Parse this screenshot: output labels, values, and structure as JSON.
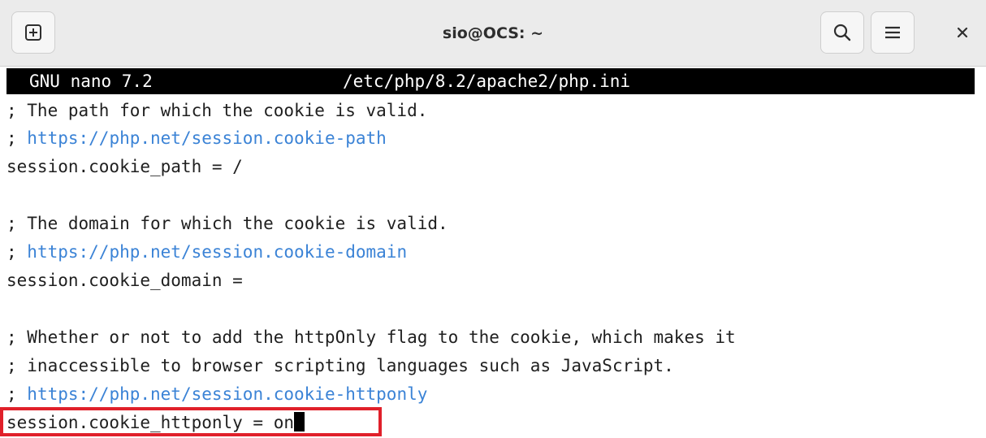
{
  "window": {
    "title": "sio@OCS: ~"
  },
  "icons": {
    "new_tab": "new-tab-icon",
    "search": "search-icon",
    "menu": "hamburger-menu-icon",
    "close": "close-icon"
  },
  "colors": {
    "titlebar_bg": "#ebebeb",
    "link": "#3b83d6",
    "highlight": "#e0202a",
    "header_bg": "#000000"
  },
  "nano": {
    "version": "GNU nano 7.2",
    "filepath": "/etc/php/8.2/apache2/php.ini"
  },
  "lines": {
    "l1": "; The path for which the cookie is valid.",
    "l2_prefix": "; ",
    "l2_link": "https://php.net/session.cookie-path",
    "l3": "session.cookie_path = /",
    "l5": "; The domain for which the cookie is valid.",
    "l6_prefix": "; ",
    "l6_link": "https://php.net/session.cookie-domain",
    "l7": "session.cookie_domain =",
    "l9": "; Whether or not to add the httpOnly flag to the cookie, which makes it",
    "l10": "; inaccessible to browser scripting languages such as JavaScript.",
    "l11_prefix": "; ",
    "l11_link": "https://php.net/session.cookie-httponly",
    "l12": "session.cookie_httponly = on"
  }
}
